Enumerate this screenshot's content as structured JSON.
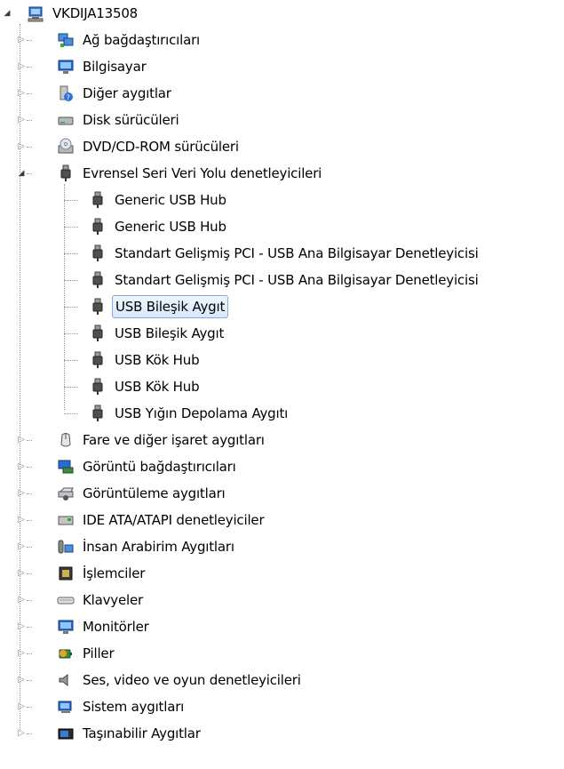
{
  "root": {
    "label": "VKDIJA13508",
    "icon": "computer-icon"
  },
  "categories": [
    {
      "label": "Ağ bağdaştırıcıları",
      "icon": "network-adapter-icon"
    },
    {
      "label": "Bilgisayar",
      "icon": "computer-monitor-icon"
    },
    {
      "label": "Diğer aygıtlar",
      "icon": "unknown-device-icon"
    },
    {
      "label": "Disk sürücüleri",
      "icon": "disk-drive-icon"
    },
    {
      "label": "DVD/CD-ROM sürücüleri",
      "icon": "dvd-drive-icon"
    },
    {
      "label": "Evrensel Seri Veri Yolu denetleyicileri",
      "icon": "usb-plug-icon",
      "expanded": true,
      "children": [
        {
          "label": "Generic USB Hub",
          "icon": "usb-plug-icon"
        },
        {
          "label": "Generic USB Hub",
          "icon": "usb-plug-icon"
        },
        {
          "label": "Standart Gelişmiş PCI - USB Ana Bilgisayar Denetleyicisi",
          "icon": "usb-plug-icon"
        },
        {
          "label": "Standart Gelişmiş PCI - USB Ana Bilgisayar Denetleyicisi",
          "icon": "usb-plug-icon"
        },
        {
          "label": "USB Bileşik Aygıt",
          "icon": "usb-plug-icon",
          "selected": true
        },
        {
          "label": "USB Bileşik Aygıt",
          "icon": "usb-plug-icon"
        },
        {
          "label": "USB Kök Hub",
          "icon": "usb-plug-icon"
        },
        {
          "label": "USB Kök Hub",
          "icon": "usb-plug-icon"
        },
        {
          "label": "USB Yığın Depolama Aygıtı",
          "icon": "usb-plug-icon"
        }
      ]
    },
    {
      "label": "Fare ve diğer işaret aygıtları",
      "icon": "mouse-icon"
    },
    {
      "label": "Görüntü bağdaştırıcıları",
      "icon": "display-adapter-icon"
    },
    {
      "label": "Görüntüleme aygıtları",
      "icon": "imaging-device-icon"
    },
    {
      "label": "IDE ATA/ATAPI denetleyiciler",
      "icon": "ide-controller-icon"
    },
    {
      "label": "İnsan Arabirim Aygıtları",
      "icon": "hid-icon"
    },
    {
      "label": "İşlemciler",
      "icon": "processor-icon"
    },
    {
      "label": "Klavyeler",
      "icon": "keyboard-icon"
    },
    {
      "label": "Monitörler",
      "icon": "monitor-icon"
    },
    {
      "label": "Piller",
      "icon": "battery-icon"
    },
    {
      "label": "Ses, video ve oyun denetleyicileri",
      "icon": "speaker-icon"
    },
    {
      "label": "Sistem aygıtları",
      "icon": "system-device-icon"
    },
    {
      "label": "Taşınabilir Aygıtlar",
      "icon": "portable-device-icon"
    }
  ]
}
